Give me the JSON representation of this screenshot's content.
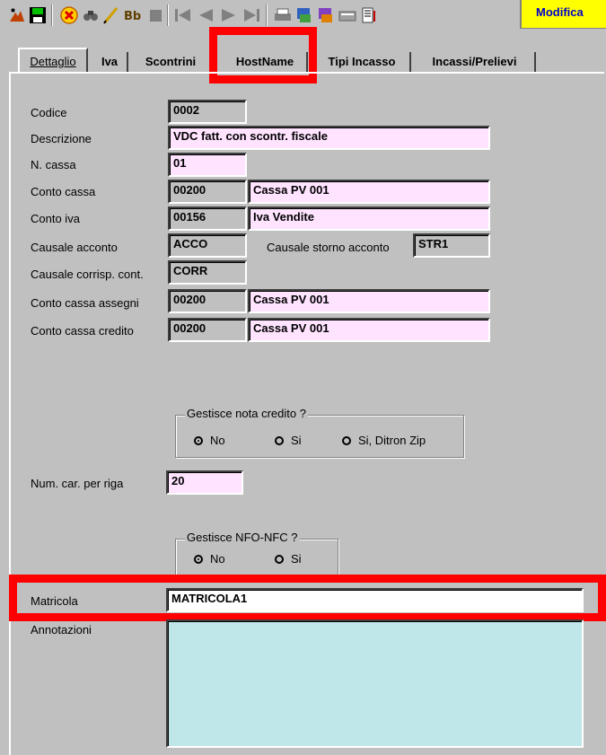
{
  "toolbar": {
    "icons": [
      "new-record-icon",
      "save-icon",
      "delete-icon",
      "find-icon",
      "edit-pencil-icon",
      "binoculars-icon",
      "stop-icon",
      "first-record-icon",
      "previous-record-icon",
      "next-record-icon",
      "last-record-icon",
      "print-icon",
      "export-icon",
      "import-icon",
      "calculator-icon",
      "report-icon"
    ],
    "mode_label": "Modifica"
  },
  "tabs": [
    {
      "label": "Dettaglio",
      "active": true
    },
    {
      "label": "Iva",
      "active": false
    },
    {
      "label": "Scontrini",
      "active": false
    },
    {
      "label": "HostName",
      "active": false
    },
    {
      "label": "Tipi Incasso",
      "active": false
    },
    {
      "label": "Incassi/Prelievi",
      "active": false
    }
  ],
  "form": {
    "codice": {
      "label": "Codice",
      "value": "0002"
    },
    "descrizione": {
      "label": "Descrizione",
      "value": "VDC fatt. con scontr. fiscale"
    },
    "n_cassa": {
      "label": "N. cassa",
      "value": "01"
    },
    "conto_cassa": {
      "label": "Conto cassa",
      "code": "00200",
      "desc": "Cassa  PV 001"
    },
    "conto_iva": {
      "label": "Conto iva",
      "code": "00156",
      "desc": "Iva Vendite"
    },
    "causale_acconto": {
      "label": "Causale acconto",
      "value": "ACCO"
    },
    "causale_storno": {
      "label": "Causale storno acconto",
      "value": "STR1"
    },
    "causale_corrisp": {
      "label": "Causale corrisp. cont.",
      "value": "CORR"
    },
    "conto_cassa_assegni": {
      "label": "Conto cassa assegni",
      "code": "00200",
      "desc": "Cassa  PV 001"
    },
    "conto_cassa_credito": {
      "label": "Conto cassa credito",
      "code": "00200",
      "desc": "Cassa  PV 001"
    },
    "nota_credito": {
      "legend": "Gestisce nota credito ?",
      "options": [
        "No",
        "Si",
        "Si, Ditron Zip"
      ],
      "selected": "No"
    },
    "num_car": {
      "label": "Num. car. per riga",
      "value": "20"
    },
    "nfo_nfc": {
      "legend": "Gestisce NFO-NFC ?",
      "options": [
        "No",
        "Si"
      ],
      "selected": "No"
    },
    "matricola": {
      "label": "Matricola",
      "value": "MATRICOLA1"
    },
    "annotazioni": {
      "label": "Annotazioni",
      "value": ""
    }
  },
  "colors": {
    "background": "#c0c0c0",
    "field_pink": "#ffe3ff",
    "field_cyan": "#bfe6e8",
    "highlight": "#ff0000",
    "mode_badge": "#ffff00"
  }
}
